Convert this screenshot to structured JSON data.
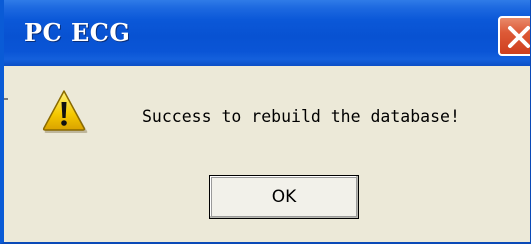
{
  "window": {
    "title": "PC ECG"
  },
  "dialog": {
    "message": "Success to rebuild the database!",
    "icon": "warning-icon",
    "ok_label": "OK"
  },
  "colors": {
    "titlebar": "#0852d2",
    "close_button": "#dd5a37",
    "dialog_background": "#ece9d8"
  }
}
